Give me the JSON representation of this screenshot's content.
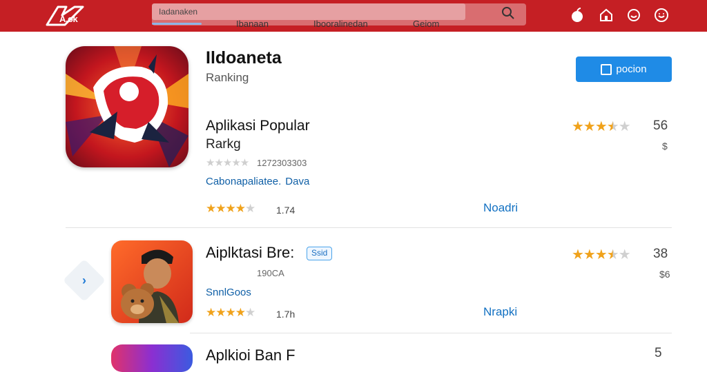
{
  "header": {
    "logo_text": "A.ok",
    "search_placeholder": "Iadanaken",
    "nav": [
      "Ibanaan",
      "Ibooralinedan",
      "Geiom"
    ],
    "icons": [
      "apple-icon",
      "home-icon",
      "chat-icon",
      "account-icon"
    ]
  },
  "featured": {
    "title": "Ildoaneta",
    "subtitle": "Ranking",
    "open_label": "pocion",
    "section_title": "Aplikasi Popular",
    "section_sub": "Rarkg",
    "rating_count": "1272303303",
    "developer": "Cabonapaliatee.",
    "developer_link": "Dava",
    "stars": 4,
    "rating_small": "1.74",
    "link": "Noadri",
    "score": "56",
    "price": "$",
    "score_stars": 3.5
  },
  "list": [
    {
      "title": "Aiplktasi Bre:",
      "badge": "Ssid",
      "count": "190CA",
      "developer": "SnnlGoos",
      "stars": 4,
      "rating_small": "1.7h",
      "link": "Nrapki",
      "score": "38",
      "price": "$6",
      "score_stars": 3.5
    },
    {
      "title": "Aplkioi Ban F",
      "score": "5"
    }
  ],
  "colors": {
    "header_red": "#c51f24",
    "accent_blue": "#1f8be6",
    "star_gold": "#f0a21b",
    "link_blue": "#1170c2"
  }
}
